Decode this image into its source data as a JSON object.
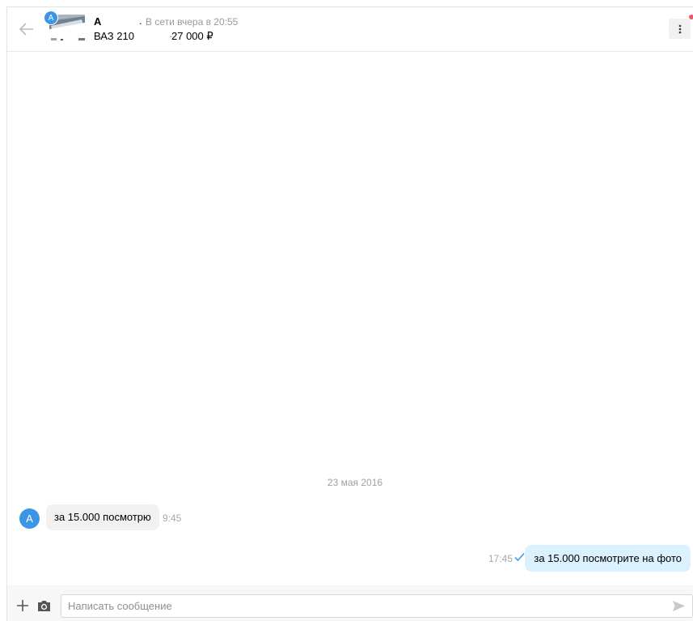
{
  "header": {
    "seller_name": "А",
    "seller_name_trailing": ".",
    "seller_status": "В сети вчера в 20:55",
    "ad_title": "ВАЗ 210",
    "ad_price_separator": "·",
    "ad_price": "27 000 ₽",
    "thumb_avatar_letter": "А"
  },
  "conversation": {
    "date_separator": "23 мая 2016",
    "messages": [
      {
        "direction": "incoming",
        "avatar_letter": "А",
        "text": "за 15.000 посмотрю",
        "time": "9:45"
      },
      {
        "direction": "outgoing",
        "text": "за 15.000 посмотрите на фото",
        "time": "17:45"
      }
    ]
  },
  "composer": {
    "placeholder": "Написать сообщение"
  },
  "colors": {
    "accent": "#3d95e8",
    "incoming_bubble": "#f1f1f1",
    "outgoing_bubble": "#dbf1fd",
    "notification_dot": "#f4516c"
  },
  "icons": {
    "back": "arrow-left-icon",
    "menu": "kebab-menu-icon",
    "read_status": "check-icon",
    "attach": "plus-icon",
    "photo": "camera-icon",
    "send": "paper-plane-icon"
  }
}
